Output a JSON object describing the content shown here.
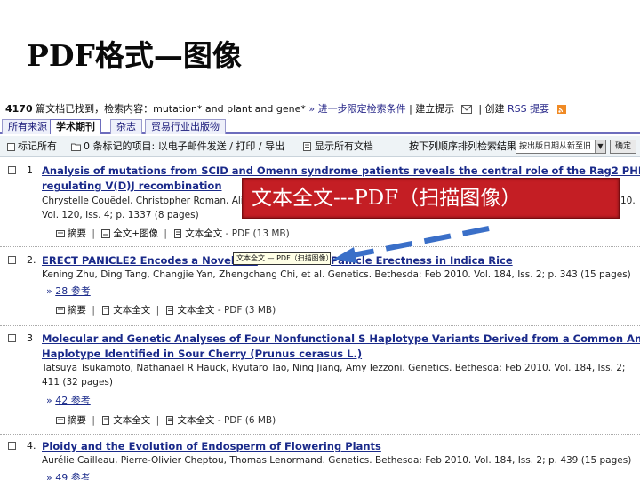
{
  "slide": {
    "title": "PDF格式—图像"
  },
  "status": {
    "count": "4170",
    "text": " 篇文档已找到，检索内容：mutation* and plant and gene*",
    "refine": "» 进一步限定检索条件",
    "alert": "| 建立提示",
    "create": "| 创建",
    "rss": "RSS 提要"
  },
  "tabs": [
    {
      "label": "所有来源"
    },
    {
      "label": "学术期刊"
    },
    {
      "label": "杂志"
    },
    {
      "label": "贸易行业出版物"
    }
  ],
  "toolbar": {
    "mark_all": "标记所有",
    "marked": "0 条标记的项目: 以电子邮件发送 / 打印 / 导出",
    "show_all": "显示所有文档",
    "sort_label": "按下列顺序排列检索结果:",
    "sort_value": "按出版日期从新至旧",
    "ok_label": "确定"
  },
  "results": [
    {
      "num": "1",
      "title_1": "Analysis of mutations from SCID and Omenn syndrome patients reveals the central role of the Rag2 PHD domain in",
      "title_2": "regulating V(D)J recombination",
      "authors": "Chrystelle Couëdel, Christopher Roman, Alison",
      "authors_tail": "10.",
      "source": "Vol. 120, Iss. 4; p. 1337 (8 pages)",
      "fmt_1": "摘要",
      "fmt_2": "全文+图像",
      "fmt_3": "文本全文",
      "fmt_tail": "- PDF (13 MB)"
    },
    {
      "num": "2.",
      "title": "ERECT PANICLE2 Encodes a Novel Pro",
      "title_tail": "Panicle Erectness in Indica Rice",
      "meta": "Kening Zhu, Ding Tang, Changjie Yan, Zhengchang Chi, et al. Genetics. Bethesda: Feb 2010. Vol. 184, Iss. 2; p. 343 (15 pages)",
      "refs": "28 参考",
      "fmt_1": "摘要",
      "fmt_2": "文本全文",
      "fmt_3": "文本全文",
      "fmt_tail": "- PDF (3 MB)"
    },
    {
      "num": "3",
      "title_1": "Molecular and Genetic Analyses of Four Nonfunctional S Haplotype Variants Derived from a Common Ancestral S",
      "title_2": "Haplotype Identified in Sour Cherry (Prunus cerasus L.)",
      "meta": "Tatsuya Tsukamoto, Nathanael R Hauck, Ryutaro Tao, Ning Jiang, Amy Iezzoni. Genetics. Bethesda: Feb 2010. Vol. 184, Iss. 2;",
      "pages": "411 (32 pages)",
      "refs": "42 参考",
      "fmt_1": "摘要",
      "fmt_2": "文本全文",
      "fmt_3": "文本全文",
      "fmt_tail": "- PDF (6 MB)"
    },
    {
      "num": "4.",
      "title": "Ploidy and the Evolution of Endosperm of Flowering Plants",
      "meta": "Aurélie Cailleau, Pierre-Olivier Cheptou, Thomas Lenormand. Genetics. Bethesda: Feb 2010. Vol. 184, Iss. 2; p. 439 (15 pages)",
      "refs": "49 参考"
    }
  ],
  "callout": {
    "text": "文本全文---PDF（扫描图像）"
  },
  "tooltip": {
    "text": "文本全文 — PDF（扫描图像）"
  },
  "colors": {
    "callout": "#c41e24",
    "arrow": "#3a6fc8",
    "link": "#1a2a8a"
  }
}
